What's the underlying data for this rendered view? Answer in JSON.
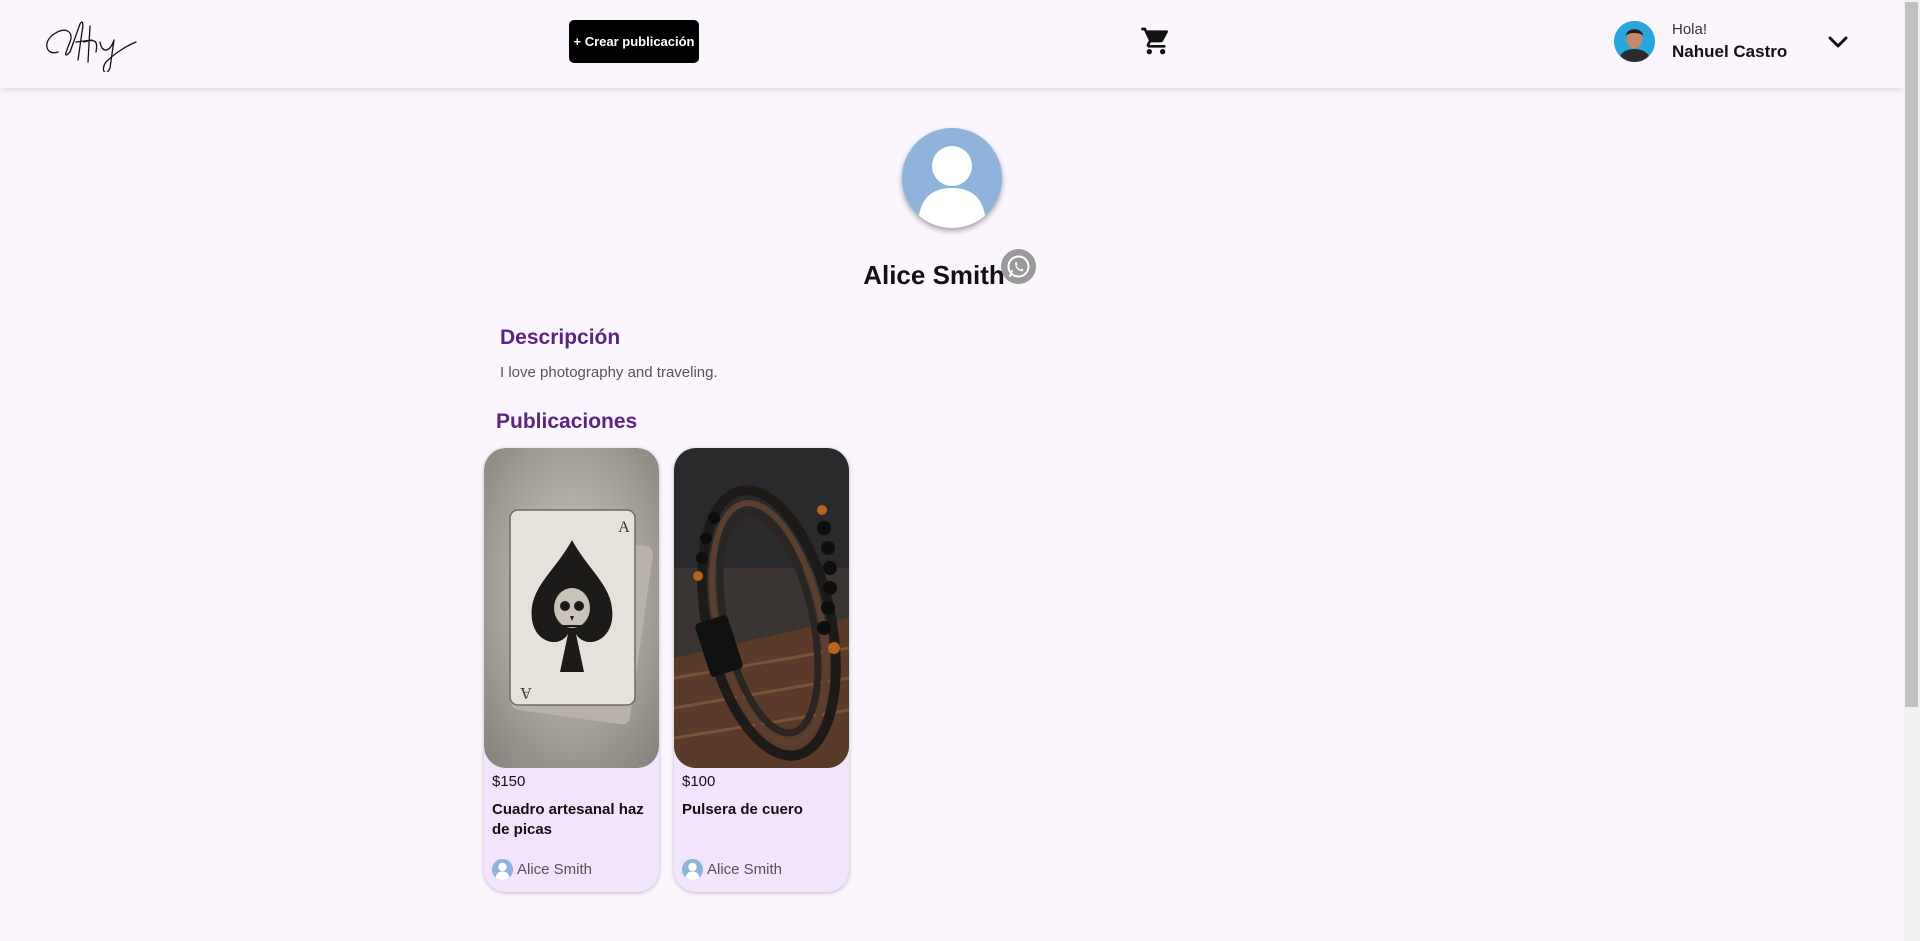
{
  "header": {
    "logo_text": "Artfy",
    "create_button_label": "+ Crear publicación",
    "greeting": "Hola!",
    "user_name": "Nahuel Castro"
  },
  "profile": {
    "name": "Alice Smith",
    "description_title": "Descripción",
    "description": "I love photography and traveling.",
    "publications_title": "Publicaciones"
  },
  "publications": [
    {
      "price": "$150",
      "title": "Cuadro artesanal haz de picas",
      "seller": "Alice Smith"
    },
    {
      "price": "$100",
      "title": "Pulsera de cuero",
      "seller": "Alice Smith"
    }
  ],
  "colors": {
    "background": "#fbf6fe",
    "accent_purple": "#5a2580",
    "card_background": "#f3e4fd",
    "avatar_placeholder": "#8fb4dc"
  }
}
